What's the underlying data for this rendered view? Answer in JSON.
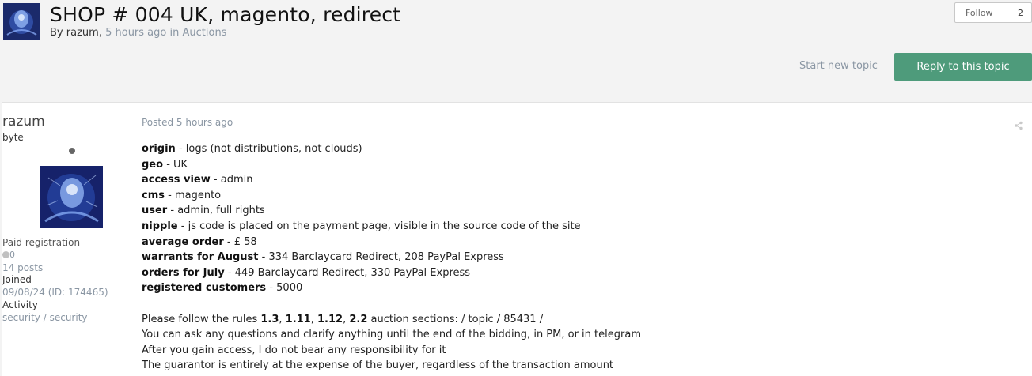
{
  "topic": {
    "title": "SHOP # 004 UK, magento, redirect",
    "by_prefix": "By",
    "author": "razum",
    "comma": ",",
    "time": "5 hours ago",
    "in_word": "in",
    "forum": "Auctions"
  },
  "follow": {
    "label": "Follow",
    "count": "2"
  },
  "actions": {
    "start_topic": "Start new topic",
    "reply": "Reply to this topic"
  },
  "post": {
    "author": {
      "name": "razum",
      "rank": "byte",
      "group": "Paid registration",
      "reputation": "0",
      "posts": "14 posts",
      "joined_label": "Joined",
      "joined_value": "09/08/24 (ID: 174465)",
      "activity_label": "Activity",
      "activity_value": "security / security"
    },
    "posted": "Posted 5 hours ago",
    "fields": [
      {
        "key": "origin",
        "sep": " - ",
        "value": "logs (not distributions, not clouds)"
      },
      {
        "key": "geo",
        "sep": " - ",
        "value": "UK"
      },
      {
        "key": "access view",
        "sep": " - ",
        "value": "admin"
      },
      {
        "key": "cms",
        "sep": " - ",
        "value": "magento"
      },
      {
        "key": "user",
        "sep": " - ",
        "value": "admin, full rights"
      },
      {
        "key": "nipple",
        "sep": " - ",
        "value": "js code is placed on the payment page, visible in the source code of the site"
      },
      {
        "key": "average order",
        "sep": " - ",
        "value": "£ 58"
      },
      {
        "key": "warrants for August",
        "sep": " - ",
        "value": "334 Barclaycard Redirect, 208 PayPal Express"
      },
      {
        "key": "orders for July",
        "sep": " - ",
        "value": "449 Barclaycard Redirect, 330 PayPal Express"
      },
      {
        "key": "registered customers",
        "sep": " - ",
        "value": "5000"
      }
    ],
    "rules": {
      "prefix": "Please follow the rules ",
      "r1": "1.3",
      "s1": ", ",
      "r2": "1.11",
      "s2": ", ",
      "r3": "1.12",
      "s3": ", ",
      "r4": "2.2",
      "suffix": " auction sections: / topic / 85431 /"
    },
    "notes": [
      "You can ask any questions and clarify anything until the end of the bidding, in PM, or in telegram",
      "After you gain access, I do not bear any responsibility for it",
      "The guarantor is entirely at the expense of the buyer, regardless of the transaction amount"
    ]
  },
  "colors": {
    "accent": "#4e9b7b",
    "muted": "#8a96a3"
  },
  "icons": [
    "avatar-image",
    "share-icon",
    "status-dot-icon",
    "reputation-dot-icon"
  ]
}
